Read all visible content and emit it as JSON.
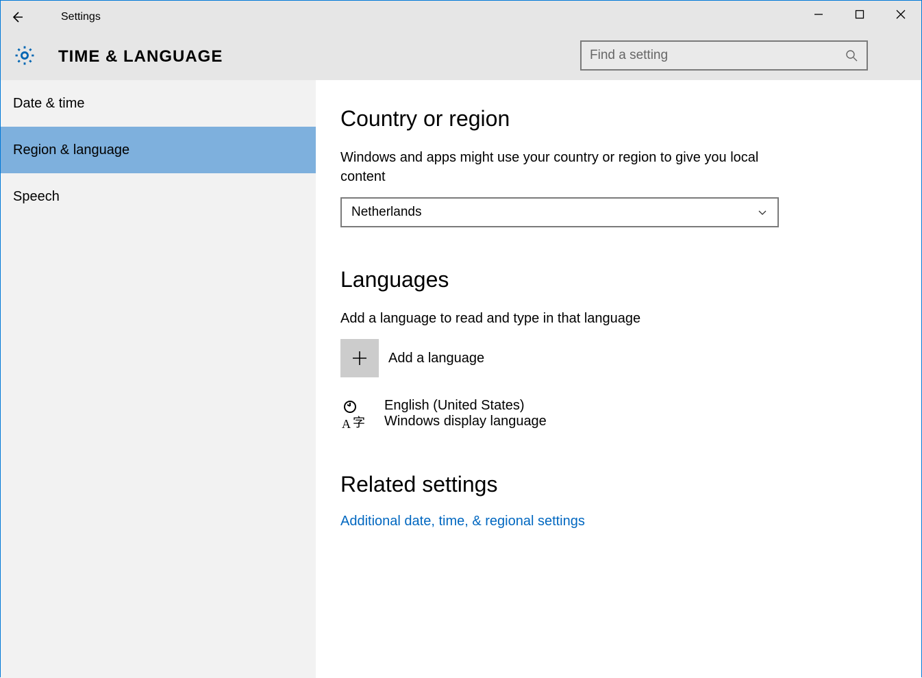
{
  "window": {
    "title": "Settings"
  },
  "header": {
    "category": "TIME & LANGUAGE",
    "search_placeholder": "Find a setting"
  },
  "sidebar": {
    "items": [
      {
        "label": "Date & time",
        "selected": false
      },
      {
        "label": "Region & language",
        "selected": true
      },
      {
        "label": "Speech",
        "selected": false
      }
    ]
  },
  "content": {
    "country": {
      "heading": "Country or region",
      "desc": "Windows and apps might use your country or region to give you local content",
      "selected": "Netherlands"
    },
    "languages": {
      "heading": "Languages",
      "desc": "Add a language to read and type in that language",
      "add_label": "Add a language",
      "installed": [
        {
          "name": "English (United States)",
          "sub": "Windows display language"
        }
      ]
    },
    "related": {
      "heading": "Related settings",
      "link": "Additional date, time, & regional settings"
    }
  }
}
